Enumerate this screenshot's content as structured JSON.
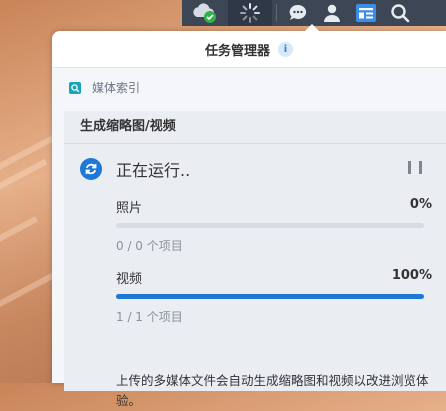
{
  "panel": {
    "title": "任务管理器",
    "info_icon": "i",
    "section": "媒体索引",
    "card_title": "生成缩略图/视频",
    "status": "正在运行..",
    "items": [
      {
        "label": "照片",
        "percent_text": "0%",
        "progress": 0.0,
        "count": "0 / 0 个项目"
      },
      {
        "label": "视频",
        "percent_text": "100%",
        "progress": 1.0,
        "count": "1 / 1 个项目"
      }
    ],
    "footer": "上传的多媒体文件会自动生成缩略图和视频以改进浏览体验。"
  },
  "topbar_icons": [
    "cloud-sync-icon",
    "spinner-icon",
    "chat-icon",
    "user-icon",
    "widgets-icon",
    "search-icon"
  ],
  "colors": {
    "accent": "#1e78d6",
    "topbar": "#3c4655",
    "success": "#2fb24a"
  }
}
